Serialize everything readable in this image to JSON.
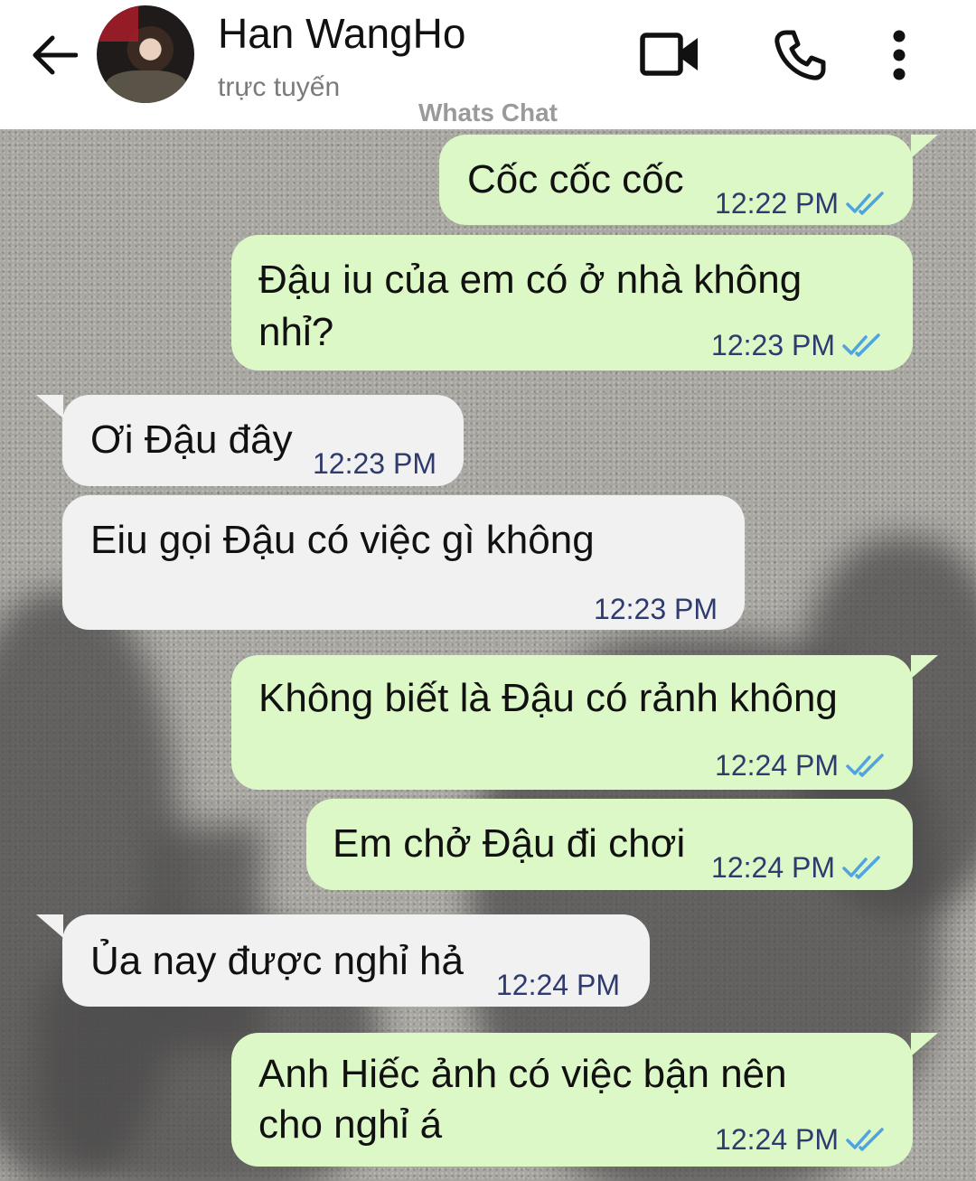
{
  "header": {
    "contact_name": "Han WangHo",
    "status": "trực tuyến",
    "watermark": "Whats Chat"
  },
  "icons": {
    "back": "arrow-left-icon",
    "video": "video-camera-icon",
    "call": "phone-icon",
    "more": "more-vertical-icon",
    "read": "double-check-icon"
  },
  "colors": {
    "outgoing_bubble": "#dcf8c6",
    "incoming_bubble": "#f1f1f1",
    "read_tick": "#4fa3e0",
    "timestamp": "#2f3a6e"
  },
  "messages": [
    {
      "direction": "out",
      "lines": [
        "Cốc cốc cốc"
      ],
      "time": "12:22 PM",
      "status": "read"
    },
    {
      "direction": "out",
      "lines": [
        "Đậu iu của em có ở nhà không",
        "nhỉ?"
      ],
      "time": "12:23 PM",
      "status": "read"
    },
    {
      "direction": "in",
      "lines": [
        "Ơi Đậu đây"
      ],
      "time": "12:23 PM"
    },
    {
      "direction": "in",
      "lines": [
        "Eiu gọi Đậu có việc gì không"
      ],
      "time": "12:23 PM"
    },
    {
      "direction": "out",
      "lines": [
        "Không biết là Đậu có rảnh không"
      ],
      "time": "12:24 PM",
      "status": "read"
    },
    {
      "direction": "out",
      "lines": [
        "Em chở Đậu đi chơi"
      ],
      "time": "12:24 PM",
      "status": "read"
    },
    {
      "direction": "in",
      "lines": [
        "Ủa nay được nghỉ hả"
      ],
      "time": "12:24 PM"
    },
    {
      "direction": "out",
      "lines": [
        "Anh Hiếc ảnh có việc bận nên",
        "cho nghỉ á"
      ],
      "time": "12:24 PM",
      "status": "read"
    }
  ]
}
